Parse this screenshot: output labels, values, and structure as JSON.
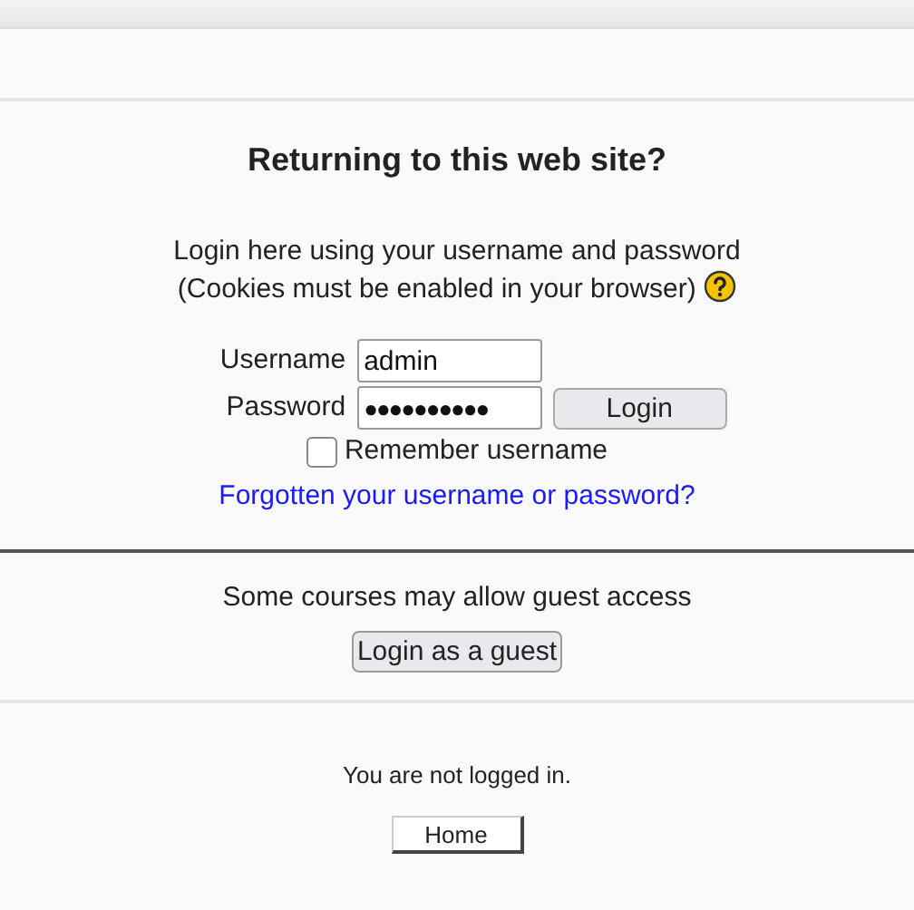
{
  "heading": "Returning to this web site?",
  "intro": [
    "Login here using your username and password",
    "(Cookies must be enabled in your browser)"
  ],
  "fields": [
    {
      "label": "Username",
      "value": "admin"
    },
    {
      "label": "Password",
      "value": "●●●●●●●●●●"
    }
  ],
  "login_button": "Login",
  "remember": {
    "label": "Remember username",
    "checked": false
  },
  "forgot_link": "Forgotten your username or password?",
  "guest": {
    "text": "Some courses may allow guest access",
    "button": "Login as a guest"
  },
  "footer": {
    "status": "You are not logged in.",
    "home_button": "Home"
  }
}
